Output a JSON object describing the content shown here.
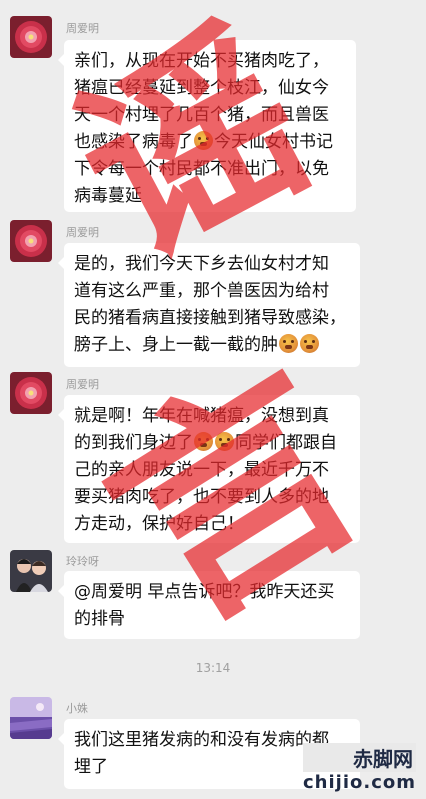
{
  "messages": [
    {
      "sender": "周爱明",
      "lines": [
        "亲们，从现在开始不买猪肉吃了，",
        "猪瘟已经蔓延到整个枝江，仙女今",
        "天一个村埋了几百个猪，而且兽医",
        "也感染了病毒了",
        "今天仙女村书记",
        "下令每一个村民都不准出门，以免",
        "病毒蔓延"
      ]
    },
    {
      "sender": "周爱明",
      "lines": [
        "是的，我们今天下乡去仙女村才知",
        "道有这么严重，那个兽医因为给村",
        "民的猪看病直接接触到猪导致感染，",
        "膀子上、身上一截一截的肿"
      ]
    },
    {
      "sender": "周爱明",
      "lines": [
        "就是啊！年年在喊猪瘟，没想到真",
        "的到我们身边了",
        "同学们都跟自",
        "己的亲人朋友说一下，最近千万不",
        "要买猪肉吃了，也不要到人多的地",
        "方走动，保护好自己！"
      ]
    },
    {
      "sender": "玲玲呀",
      "lines": [
        "@周爱明  早点告诉吧？我昨天还买",
        "的排骨"
      ]
    },
    {
      "sender": "小姝",
      "lines": [
        "我们这里猪发病的和没有发病的都",
        "埋了"
      ]
    }
  ],
  "timestamp": "13:14",
  "stamp": {
    "char1": "谣",
    "char2": "言",
    "color": "#e6282d"
  },
  "watermark": {
    "cn": "赤脚网",
    "en": "chijio.com"
  },
  "icons": [
    "flower-avatar",
    "flower-avatar",
    "flower-avatar",
    "photo-avatar",
    "lavender-avatar",
    "emoji-face"
  ]
}
